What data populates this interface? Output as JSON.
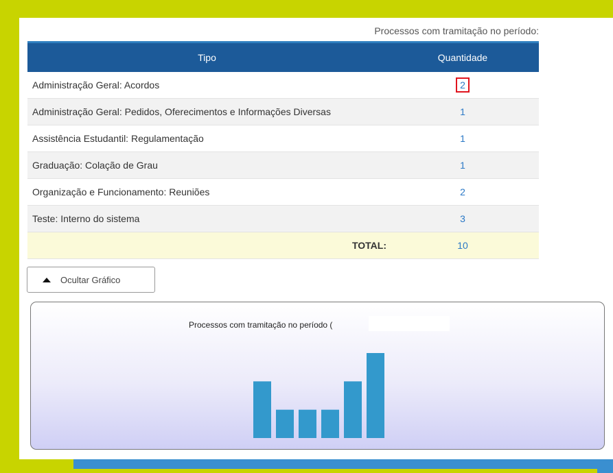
{
  "caption": "Processos com tramitação no período:",
  "table": {
    "headers": {
      "tipo": "Tipo",
      "quantidade": "Quantidade"
    },
    "rows": [
      {
        "tipo": "Administração Geral: Acordos",
        "quantidade": "2"
      },
      {
        "tipo": "Administração Geral: Pedidos, Oferecimentos e Informações Diversas",
        "quantidade": "1"
      },
      {
        "tipo": "Assistência Estudantil: Regulamentação",
        "quantidade": "1"
      },
      {
        "tipo": "Graduação: Colação de Grau",
        "quantidade": "1"
      },
      {
        "tipo": "Organização e Funcionamento: Reuniões",
        "quantidade": "2"
      },
      {
        "tipo": "Teste: Interno do sistema",
        "quantidade": "3"
      }
    ],
    "total_label": "TOTAL:",
    "total_value": "10"
  },
  "toggle_button": {
    "label": "Ocultar Gráfico",
    "icon": "triangle-up-icon"
  },
  "chart_data": {
    "type": "bar",
    "title": "Processos com tramitação no período (",
    "categories": [
      "Administração Geral: Acordos",
      "Administração Geral: Pedidos, Oferecimentos e Informações Diversas",
      "Assistência Estudantil: Regulamentação",
      "Graduação: Colação de Grau",
      "Organização e Funcionamento: Reuniões",
      "Teste: Interno do sistema"
    ],
    "values": [
      2,
      1,
      1,
      1,
      2,
      3
    ],
    "ylim": [
      0,
      3
    ],
    "bar_color": "#3399cc"
  },
  "colors": {
    "header_bg": "#1c5a99",
    "link": "#2a78c6",
    "highlight_border": "#e0141e",
    "frame": "#c8d400",
    "accent_blue": "#3a8fd0"
  }
}
